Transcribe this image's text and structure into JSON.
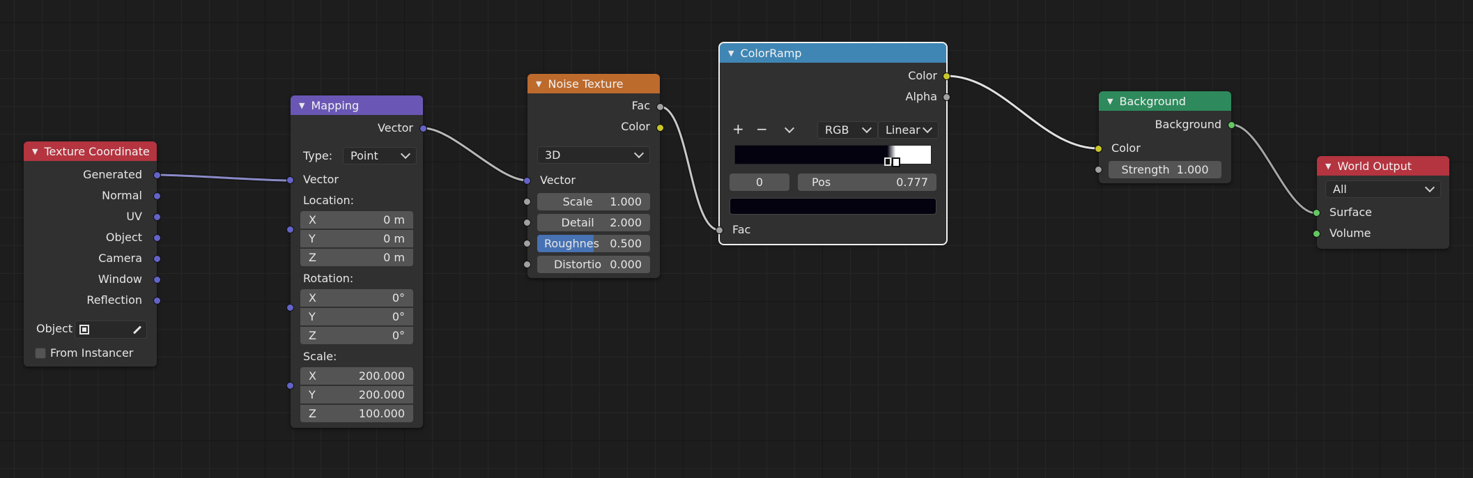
{
  "colors": {
    "background": "#1d1d1d",
    "node_body": "#303030",
    "header_input": "#b4343f",
    "header_vector": "#6a57b5",
    "header_texture": "#bd6a2d",
    "header_converter": "#3f86b4",
    "header_shader": "#2e8a5c",
    "header_output": "#b4343f",
    "socket_vector": "#6363c7",
    "socket_float": "#a1a1a1",
    "socket_color": "#c7c729",
    "socket_shader": "#63c763"
  },
  "texture_coordinate": {
    "title": "Texture Coordinate",
    "outputs": [
      "Generated",
      "Normal",
      "UV",
      "Object",
      "Camera",
      "Window",
      "Reflection"
    ],
    "object_label": "Object",
    "from_instancer_label": "From Instancer"
  },
  "mapping": {
    "title": "Mapping",
    "output_vector": "Vector",
    "type_label": "Type:",
    "type_value": "Point",
    "input_vector": "Vector",
    "location_label": "Location:",
    "location": [
      {
        "axis": "X",
        "value": "0 m"
      },
      {
        "axis": "Y",
        "value": "0 m"
      },
      {
        "axis": "Z",
        "value": "0 m"
      }
    ],
    "rotation_label": "Rotation:",
    "rotation": [
      {
        "axis": "X",
        "value": "0°"
      },
      {
        "axis": "Y",
        "value": "0°"
      },
      {
        "axis": "Z",
        "value": "0°"
      }
    ],
    "scale_label": "Scale:",
    "scale": [
      {
        "axis": "X",
        "value": "200.000"
      },
      {
        "axis": "Y",
        "value": "200.000"
      },
      {
        "axis": "Z",
        "value": "100.000"
      }
    ]
  },
  "noise_texture": {
    "title": "Noise Texture",
    "output_fac": "Fac",
    "output_color": "Color",
    "dimensions": "3D",
    "input_vector": "Vector",
    "scale_label": "Scale",
    "scale_value": "1.000",
    "detail_label": "Detail",
    "detail_value": "2.000",
    "roughness_label": "Roughnes",
    "roughness_value": "0.500",
    "roughness_fill": 0.5,
    "distortion_label": "Distortio",
    "distortion_value": "0.000"
  },
  "color_ramp": {
    "title": "ColorRamp",
    "output_color": "Color",
    "output_alpha": "Alpha",
    "add_symbol": "+",
    "remove_symbol": "−",
    "color_mode": "RGB",
    "interpolation": "Linear",
    "stop_index": "0",
    "pos_label": "Pos",
    "pos_value": "0.777",
    "ramp_start_color": "#05020f",
    "ramp_end_color": "#ffffff",
    "stop_positions": [
      0.777,
      0.82
    ],
    "selected_color": "#05020f",
    "input_fac": "Fac"
  },
  "background_node": {
    "title": "Background",
    "output_background": "Background",
    "input_color": "Color",
    "strength_label": "Strength",
    "strength_value": "1.000"
  },
  "world_output": {
    "title": "World Output",
    "target": "All",
    "input_surface": "Surface",
    "input_volume": "Volume"
  }
}
